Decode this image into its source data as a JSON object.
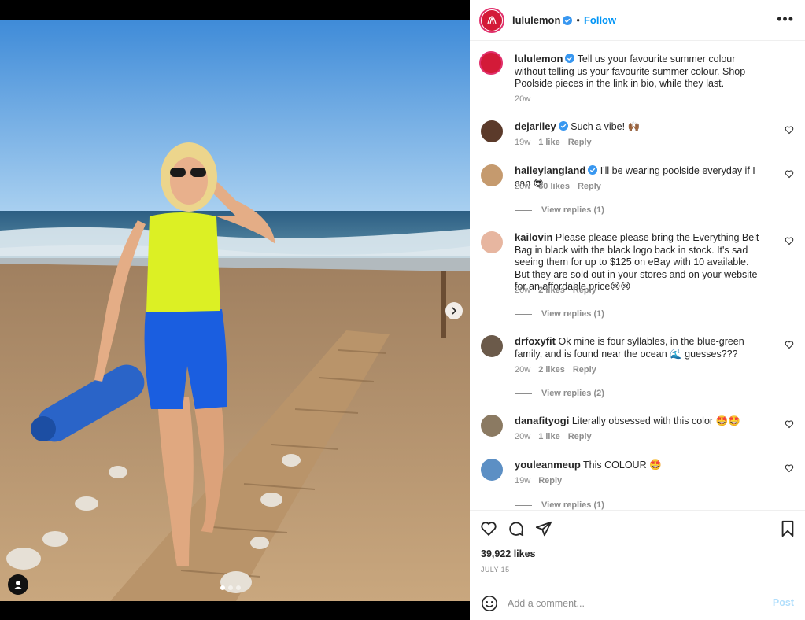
{
  "post": {
    "username": "lululemon",
    "follow_label": "Follow",
    "more_label": "•••",
    "caption": "Tell us your favourite summer colour without telling us your favourite summer colour. Shop Poolside pieces in the link in bio, while they last.",
    "caption_time": "20w"
  },
  "comments": [
    {
      "user": "dejariley",
      "verified": true,
      "text": "Such a vibe! 🙌🏾",
      "time": "19w",
      "likes": "1 like",
      "reply": "Reply"
    },
    {
      "user": "haileylangland",
      "verified": true,
      "text": "I'll be wearing poolside everyday if I can 😎",
      "time": "20w",
      "likes": "30 likes",
      "reply": "Reply",
      "view_replies": "View replies (1)"
    },
    {
      "user": "kailovin",
      "verified": false,
      "text": "Please please please bring the Everything Belt Bag in black with the black logo back in stock. It's sad seeing them for up to $125 on eBay with 10 available. But they are sold out in your stores and on your website for an affordable price😢😢",
      "time": "20w",
      "likes": "2 likes",
      "reply": "Reply",
      "view_replies": "View replies (1)"
    },
    {
      "user": "drfoxyfit",
      "verified": false,
      "text": "Ok mine is four syllables, in the blue-green family, and is found near the ocean 🌊 guesses???",
      "time": "20w",
      "likes": "2 likes",
      "reply": "Reply",
      "view_replies": "View replies (2)"
    },
    {
      "user": "danafityogi",
      "verified": false,
      "text": "Literally obsessed with this color 🤩🤩",
      "time": "20w",
      "likes": "1 like",
      "reply": "Reply"
    },
    {
      "user": "youleanmeup",
      "verified": false,
      "text": "This COLOUR 🤩",
      "time": "19w",
      "reply": "Reply",
      "view_replies": "View replies (1)"
    }
  ],
  "footer": {
    "likes": "39,922 likes",
    "date": "JULY 15",
    "comment_placeholder": "Add a comment...",
    "post_label": "Post"
  },
  "icons": {
    "like": "heart-icon",
    "comment": "comment-icon",
    "share": "share-icon",
    "save": "bookmark-icon",
    "emoji": "emoji-icon"
  },
  "colors": {
    "accent": "#0095f6",
    "brand": "#d31a38",
    "verified": "#3897f0"
  }
}
